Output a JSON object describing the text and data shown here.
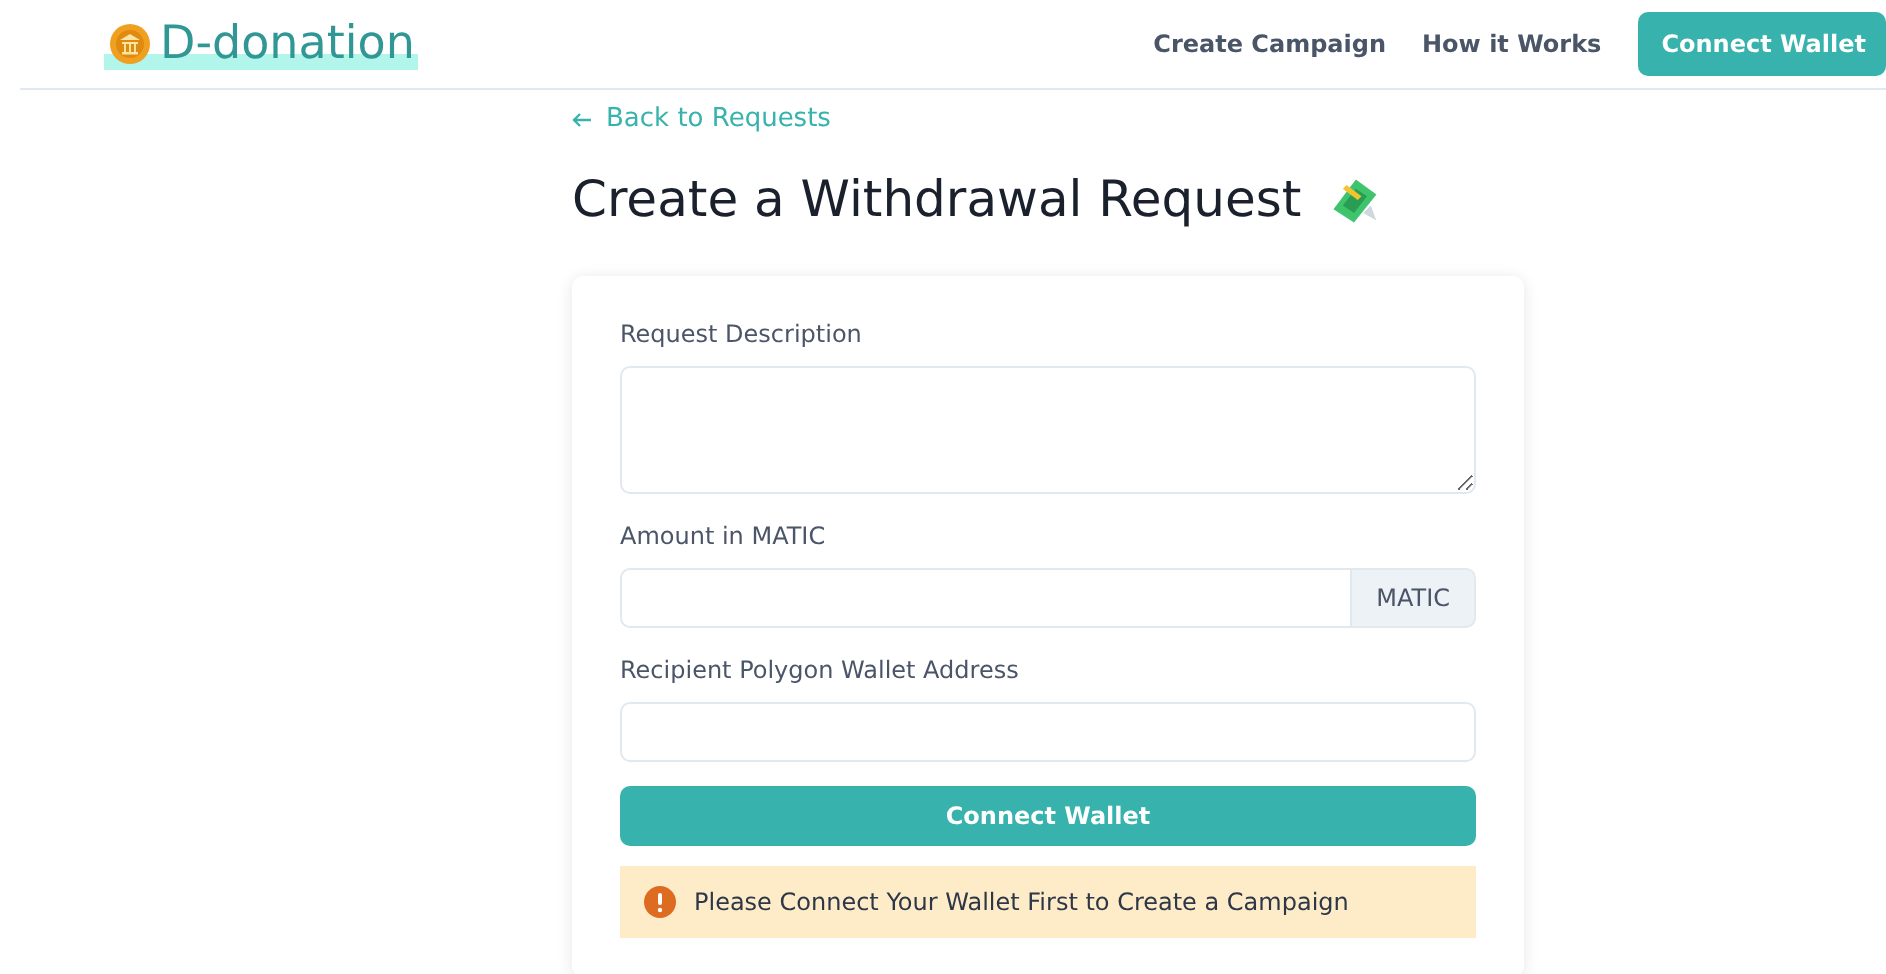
{
  "header": {
    "logo": "D-donation",
    "nav": [
      "Create Campaign",
      "How it Works"
    ],
    "button": "Connect Wallet"
  },
  "back_link": "Back to Requests",
  "title": "Create a Withdrawal Request",
  "form": {
    "fields": [
      {
        "kind": "textarea",
        "label": "Request Description"
      },
      {
        "kind": "addon",
        "label": "Amount in MATIC",
        "addon": "MATIC"
      },
      {
        "kind": "text",
        "label": "Recipient Polygon Wallet Address"
      }
    ],
    "submit": "Connect Wallet",
    "alert": "Please Connect Your Wallet First to Create a Campaign"
  }
}
